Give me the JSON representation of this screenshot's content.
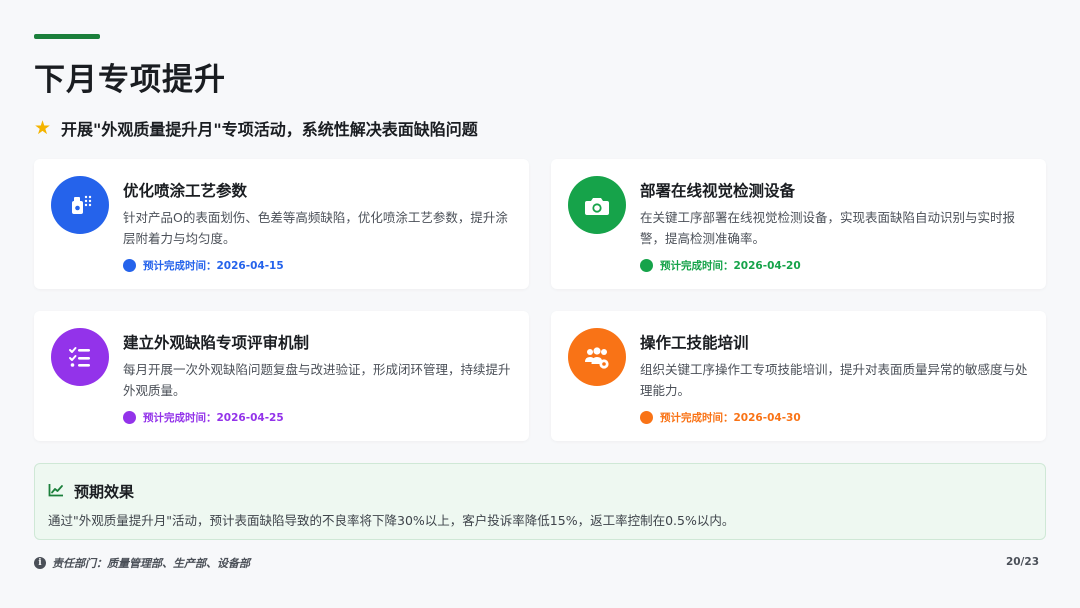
{
  "page": {
    "title": "下月专项提升",
    "subtitle": "开展\"外观质量提升月\"专项活动，系统性解决表面缺陷问题",
    "page_number": "20/23",
    "footer": "责任部门：质量管理部、生产部、设备部"
  },
  "cards": [
    {
      "icon": "spray-gun-icon",
      "color": "#2563eb",
      "title": "优化喷涂工艺参数",
      "description": "针对产品O的表面划伤、色差等高频缺陷，优化喷涂工艺参数，提升涂层附着力与均匀度。",
      "due_label": "预计完成时间：2026-04-15"
    },
    {
      "icon": "camera-icon",
      "color": "#16a34a",
      "title": "部署在线视觉检测设备",
      "description": "在关键工序部署在线视觉检测设备，实现表面缺陷自动识别与实时报警，提高检测准确率。",
      "due_label": "预计完成时间：2026-04-20"
    },
    {
      "icon": "checklist-icon",
      "color": "#9333ea",
      "title": "建立外观缺陷专项评审机制",
      "description": "每月开展一次外观缺陷问题复盘与改进验证，形成闭环管理，持续提升外观质量。",
      "due_label": "预计完成时间：2026-04-25"
    },
    {
      "icon": "users-gear-icon",
      "color": "#f97316",
      "title": "操作工技能培训",
      "description": "组织关键工序操作工专项技能培训，提升对表面质量异常的敏感度与处理能力。",
      "due_label": "预计完成时间：2026-04-30"
    }
  ],
  "effect": {
    "title": "预期效果",
    "body": "通过\"外观质量提升月\"活动，预计表面缺陷导致的不良率将下降30%以上，客户投诉率降低15%，返工率控制在0.5%以内。"
  }
}
